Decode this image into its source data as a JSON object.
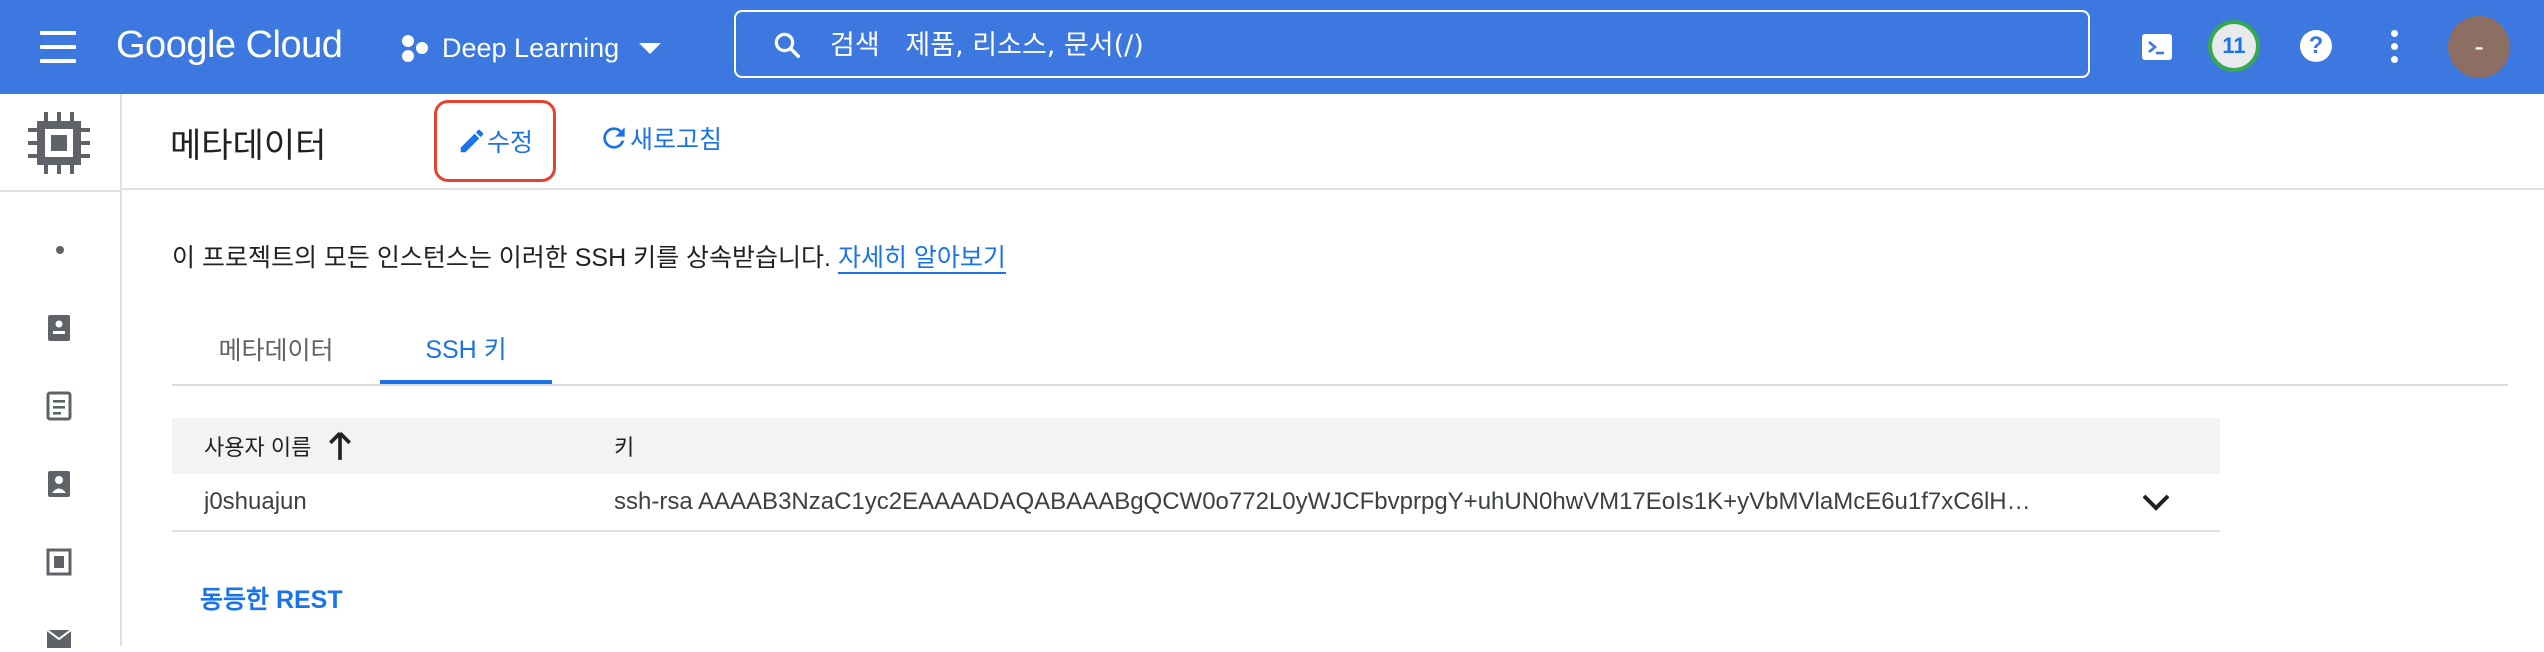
{
  "topbar": {
    "logo": "Google Cloud",
    "project": "Deep Learning",
    "search_placeholder": "검색   제품, 리소스, 문서(/)",
    "notification_count": "11",
    "help": "?",
    "avatar_initial": "-"
  },
  "header": {
    "title": "메타데이터",
    "edit_label": "수정",
    "refresh_label": "새로고침"
  },
  "info": {
    "text": "이 프로젝트의 모든 인스턴스는 이러한 SSH 키를 상속받습니다.",
    "link": "자세히 알아보기"
  },
  "tabs": [
    {
      "label": "메타데이터"
    },
    {
      "label": "SSH 키"
    }
  ],
  "table": {
    "headers": [
      "사용자 이름",
      "키"
    ],
    "rows": [
      {
        "username": "j0shuajun",
        "key": "ssh-rsa AAAAB3NzaC1yc2EAAAADAQABAAABgQCW0o772L0yWJCFbvprpgY+uhUN0hwVM17EoIs1K+yVbMVlaMcE6u1f7xC6lH…"
      }
    ]
  },
  "footer_link": "동등한 REST",
  "colors": {
    "topbar": "#3c78e0",
    "accent": "#1a73e8",
    "highlight": "#e5432f"
  }
}
